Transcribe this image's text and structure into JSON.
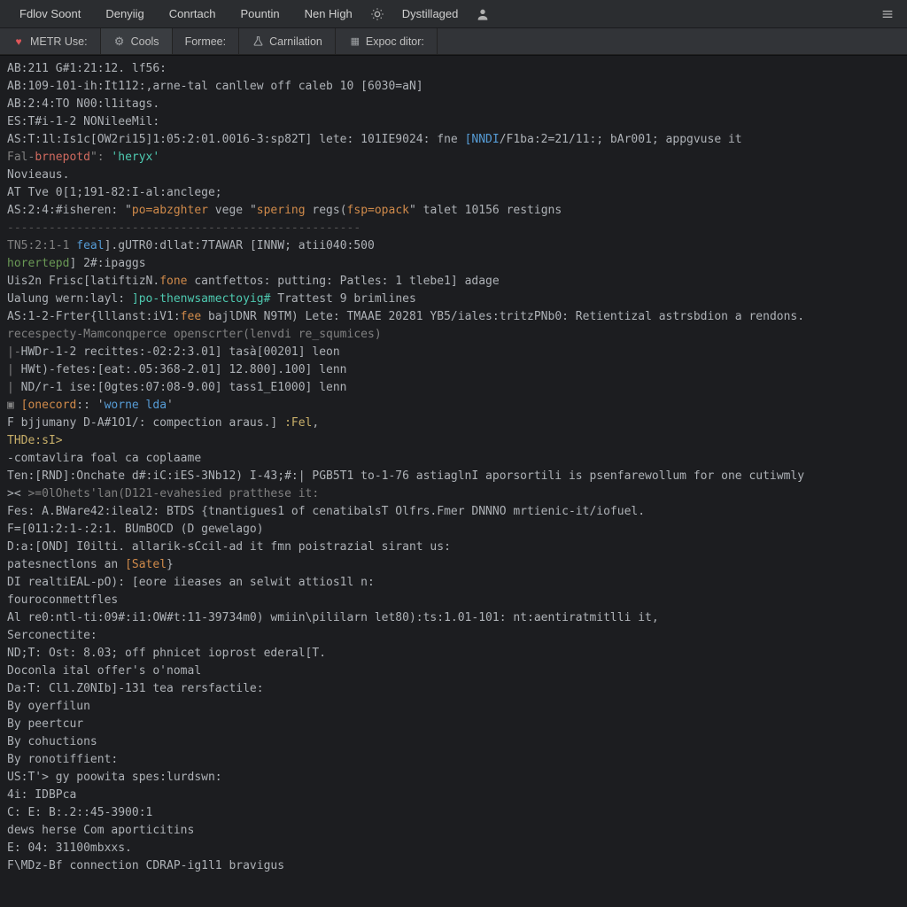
{
  "menubar": {
    "items": [
      "Fdlov Soont",
      "Denyiig",
      "Conrtach",
      "Pountin",
      "Nen High",
      "",
      "Dystillaged"
    ],
    "sun_icon": "sun-icon",
    "user_icon": "user-icon",
    "hamburger_icon": "hamburger-icon"
  },
  "tabs": [
    {
      "icon": "heart-icon",
      "label": "METR Use:",
      "active": false
    },
    {
      "icon": "gear-icon",
      "label": "Cools",
      "active": true
    },
    {
      "icon": "",
      "label": "Formee:",
      "active": false
    },
    {
      "icon": "flask-icon",
      "label": "Carnilation",
      "active": false
    },
    {
      "icon": "grid-icon",
      "label": "Expoc ditor:",
      "active": false
    }
  ],
  "console": {
    "lines": [
      {
        "segs": [
          {
            "t": "AB:211 G#1:21:12. lf56:"
          }
        ]
      },
      {
        "segs": [
          {
            "t": "AB:109-101-ih:It112:,arne-tal canllew off caleb 10 [6030=aN]"
          }
        ]
      },
      {
        "segs": [
          {
            "t": "AB:2:4:TO N00:l1itags."
          }
        ]
      },
      {
        "segs": [
          {
            "t": "ES:T#i-1-2 NONileeMil:"
          }
        ]
      },
      {
        "segs": [
          {
            "t": "AS:T:1l:Is1c[OW2ri15]1:05:2:01.0016-3:sp82T] lete: 101IE9024: fne "
          },
          {
            "t": "[NNDI",
            "c": "c-blue"
          },
          {
            "t": "/F1ba:2=21/11:; bAr001; appgvuse it"
          }
        ]
      },
      {
        "segs": [
          {
            "t": "Fal-",
            "c": "c-dim"
          },
          {
            "t": "brnepotd",
            "c": "c-red"
          },
          {
            "t": "\": ",
            "c": "c-dim"
          },
          {
            "t": "'heryx'",
            "c": "c-cyan"
          }
        ]
      },
      {
        "segs": [
          {
            "t": "Novieaus."
          }
        ]
      },
      {
        "segs": [
          {
            "t": "AT Tve 0[1;191-82:I-al:anclege;"
          }
        ]
      },
      {
        "segs": [
          {
            "t": "AS:2:4:#isheren: \""
          },
          {
            "t": "po=abzghter",
            "c": "c-orange"
          },
          {
            "t": " vege \""
          },
          {
            "t": "spering",
            "c": "c-orange"
          },
          {
            "t": " regs("
          },
          {
            "t": "fsp=opack",
            "c": "c-orange"
          },
          {
            "t": "\" talet 10156 restigns"
          }
        ]
      },
      {
        "segs": [
          {
            "t": "---------------------------------------------------",
            "c": "hr"
          }
        ]
      },
      {
        "segs": [
          {
            "t": "TN5:2:1-1 ",
            "c": "c-dim"
          },
          {
            "t": "feal",
            "c": "c-blue"
          },
          {
            "t": "].gUTR0:dllat:7TAWAR [INNW; atii040:500"
          }
        ]
      },
      {
        "segs": [
          {
            "t": "horertepd",
            "c": "c-green"
          },
          {
            "t": "] 2#:ipaggs"
          }
        ]
      },
      {
        "segs": [
          {
            "t": ""
          }
        ]
      },
      {
        "segs": [
          {
            "t": "Uis2n Frisc[latiftizN."
          },
          {
            "t": "fone",
            "c": "c-orange"
          },
          {
            "t": " cantfettos: putting: Patles: 1 tlebe1] adage"
          }
        ]
      },
      {
        "segs": [
          {
            "t": "Ualung wern:layl: "
          },
          {
            "t": "]po-thenwsamectoyig#",
            "c": "c-cyan"
          },
          {
            "t": " Trattest 9 brimlines"
          }
        ]
      },
      {
        "segs": [
          {
            "t": "AS:1-2-Frter{lllanst:iV1:"
          },
          {
            "t": "fee",
            "c": "c-orange"
          },
          {
            "t": " bajlDNR N9TM) Lete: TMAAE 20281 YB5/iales:tritzPNb0: Retientizal astrsbdion a rendons."
          }
        ]
      },
      {
        "segs": [
          {
            "t": "recespecty-Mamconqperce openscrter(lenvdi re_squmices)",
            "c": "c-dim"
          }
        ]
      },
      {
        "segs": [
          {
            "t": "|-",
            "c": "c-dim"
          },
          {
            "t": "HWDr-1-2 recittes:-02:2:3.01] tasà[00201] leon"
          }
        ]
      },
      {
        "segs": [
          {
            "t": "| ",
            "c": "c-dim"
          },
          {
            "t": "HWt)-fetes:[eat:.05:368-2.01] 12.800].100] lenn"
          }
        ]
      },
      {
        "segs": [
          {
            "t": "| ",
            "c": "c-dim"
          },
          {
            "t": "ND/r-1 ise:[0gtes:07:08-9.00] tass1_E1000] lenn"
          }
        ]
      },
      {
        "segs": [
          {
            "t": "▣ ",
            "c": "c-dim"
          },
          {
            "t": "[onecord",
            "c": "c-orange"
          },
          {
            "t": ":: '"
          },
          {
            "t": "worne lda",
            "c": "c-blue"
          },
          {
            "t": "'"
          }
        ]
      },
      {
        "segs": [
          {
            "t": "F bjjumany D-A#1O1/: compection araus.] "
          },
          {
            "t": ":Fel",
            "c": "c-yellow"
          },
          {
            "t": ","
          }
        ]
      },
      {
        "segs": [
          {
            "t": ""
          }
        ]
      },
      {
        "segs": [
          {
            "t": "THDe:sI>",
            "c": "c-yellow"
          }
        ]
      },
      {
        "segs": [
          {
            "t": "-comtavlira foal ca coplaame"
          }
        ]
      },
      {
        "segs": [
          {
            "t": "Ten:[RND]:Onchate d#:iC:iES-3Nb12) I-43;#:| PGB5T1 to-1-76 astiaglnI aporsortili is psenfarewollum for one cutiwmly"
          }
        ]
      },
      {
        "segs": [
          {
            "t": ">< "
          },
          {
            "t": ">=0lOhets'lan(D121-evahesied pratthese it:",
            "c": "c-dim"
          }
        ]
      },
      {
        "segs": [
          {
            "t": "Fes: A.BWare42:ileal2: BTDS {tnantigues1 of cenatibalsT Olfrs.Fmer DNNNO mrtienic-it/iofuel."
          }
        ]
      },
      {
        "segs": [
          {
            "t": "F=[011:2:1-:2:1. BUmBOCD (D gewelago)"
          }
        ]
      },
      {
        "segs": [
          {
            "t": "D:a:[OND] I0ilti. allarik-sCcil-ad it fmn poistrazial sirant us:"
          }
        ]
      },
      {
        "segs": [
          {
            "t": "patesnectlons an "
          },
          {
            "t": "[Satel",
            "c": "c-orange"
          },
          {
            "t": "}"
          }
        ]
      },
      {
        "segs": [
          {
            "t": "DI realtiEAL-pO): [eore iieases an selwit attios1l n:"
          }
        ]
      },
      {
        "segs": [
          {
            "t": "fouroconmettfles"
          }
        ]
      },
      {
        "segs": [
          {
            "t": "Al re0:ntl-ti:09#:i1:OW#t:11-39734m0) wmiin\\pililarn let80):ts:1.01-101: nt:aentiratmitlli it,"
          }
        ]
      },
      {
        "segs": [
          {
            "t": "Serconectite:"
          }
        ]
      },
      {
        "segs": [
          {
            "t": "ND;T: Ost: 8.03; off phnicet ioprost ederal[T."
          }
        ]
      },
      {
        "segs": [
          {
            "t": "Doconla ital offer's o'nomal"
          }
        ]
      },
      {
        "segs": [
          {
            "t": "Da:T: Cl1.Z0NIb]-131 tea rersfactile:"
          }
        ]
      },
      {
        "segs": [
          {
            "t": "By oyerfilun"
          }
        ]
      },
      {
        "segs": [
          {
            "t": "By peertcur"
          }
        ]
      },
      {
        "segs": [
          {
            "t": "By cohuctions"
          }
        ]
      },
      {
        "segs": [
          {
            "t": "By ronotiffient:"
          }
        ]
      },
      {
        "segs": [
          {
            "t": "US:T'> gy poowita spes:lurdswn:"
          }
        ]
      },
      {
        "segs": [
          {
            "t": "4i: IDBPca"
          }
        ]
      },
      {
        "segs": [
          {
            "t": "C: E: B:.2::45-3900:1"
          }
        ]
      },
      {
        "segs": [
          {
            "t": "dews herse Com aporticitins"
          }
        ]
      },
      {
        "segs": [
          {
            "t": "E: 04: 31100mbxxs."
          }
        ]
      },
      {
        "segs": [
          {
            "t": "F\\MDz-Bf connection CDRAP-ig1l1 bravigus"
          }
        ]
      }
    ]
  }
}
